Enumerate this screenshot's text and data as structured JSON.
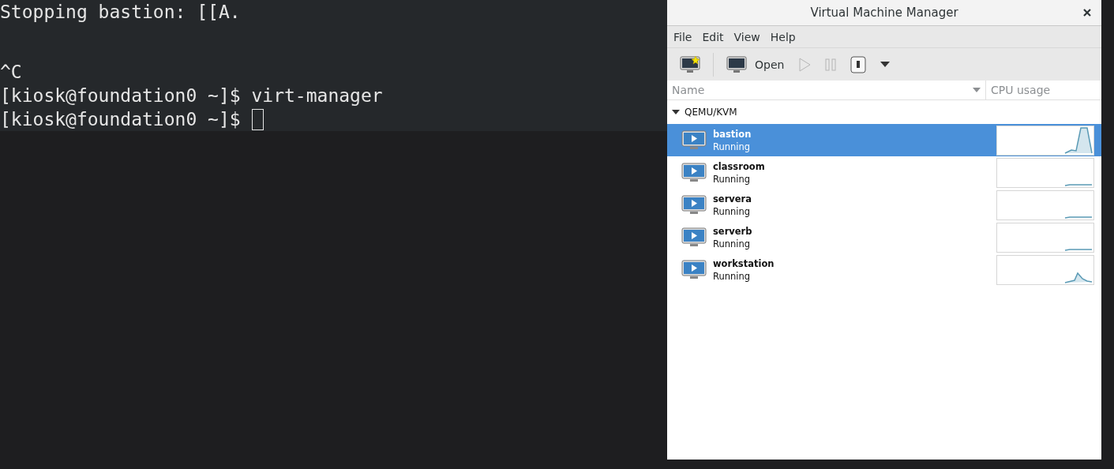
{
  "terminal": {
    "lines": [
      {
        "kind": "text",
        "text": "Stopping bastion: [[A."
      },
      {
        "kind": "blank"
      },
      {
        "kind": "blank"
      },
      {
        "kind": "text",
        "text": "^C"
      },
      {
        "kind": "text",
        "text": "[kiosk@foundation0 ~]$ virt-manager"
      },
      {
        "kind": "prompt",
        "text": "[kiosk@foundation0 ~]$ "
      }
    ]
  },
  "window": {
    "title": "Virtual Machine Manager"
  },
  "menu": [
    "File",
    "Edit",
    "View",
    "Help"
  ],
  "toolbar": [
    {
      "kind": "new",
      "disabled": false
    },
    {
      "kind": "open",
      "label": "Open",
      "disabled": false
    },
    {
      "kind": "run",
      "disabled": true
    },
    {
      "kind": "pause",
      "disabled": true
    },
    {
      "kind": "shutdown",
      "disabled": false
    },
    {
      "kind": "caret",
      "disabled": false
    }
  ],
  "table": {
    "columns": [
      "Name",
      "CPU usage"
    ],
    "group": {
      "label": "QEMU/KVM",
      "expanded": true
    },
    "rows": [
      {
        "name": "bastion",
        "status": "Running",
        "selected": true,
        "cpu_graph": {
          "kind": "spike"
        }
      },
      {
        "name": "classroom",
        "status": "Running",
        "selected": false,
        "cpu_graph": {
          "kind": "flat"
        }
      },
      {
        "name": "servera",
        "status": "Running",
        "selected": false,
        "cpu_graph": {
          "kind": "flat"
        }
      },
      {
        "name": "serverb",
        "status": "Running",
        "selected": false,
        "cpu_graph": {
          "kind": "flat"
        }
      },
      {
        "name": "workstation",
        "status": "Running",
        "selected": false,
        "cpu_graph": {
          "kind": "bump"
        }
      }
    ]
  }
}
